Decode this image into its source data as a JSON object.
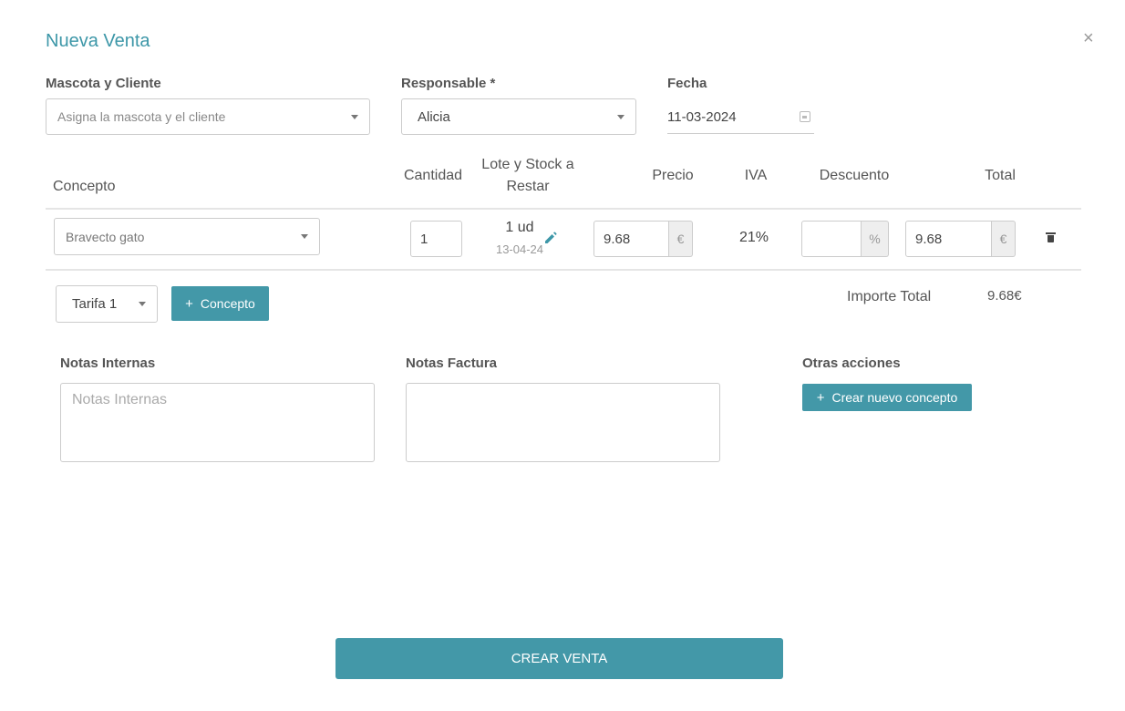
{
  "modal": {
    "title": "Nueva Venta",
    "close_symbol": "×"
  },
  "form": {
    "pet_client": {
      "label": "Mascota y Cliente",
      "placeholder": "Asigna la mascota y el cliente"
    },
    "responsible": {
      "label": "Responsable *",
      "value": "Alicia"
    },
    "date": {
      "label": "Fecha",
      "value": "11-03-2024"
    }
  },
  "table": {
    "headers": {
      "concept": "Concepto",
      "quantity": "Cantidad",
      "batch_line1": "Lote y Stock a",
      "batch_line2": "Restar",
      "price": "Precio",
      "vat": "IVA",
      "discount": "Descuento",
      "total": "Total"
    },
    "rows": [
      {
        "concept": "Bravecto gato",
        "quantity": "1",
        "stock": "1 ud",
        "batch_date": "13-04-24",
        "price": "9.68",
        "price_unit": "€",
        "vat": "21%",
        "discount": "",
        "discount_unit": "%",
        "total": "9.68",
        "total_unit": "€"
      }
    ]
  },
  "footer_row": {
    "tariff": "Tarifa 1",
    "add_concept_label": "Concepto",
    "plus_symbol": "+",
    "total_label": "Importe Total",
    "total_value": "9.68€"
  },
  "notes": {
    "internal_label": "Notas Internas",
    "internal_placeholder": "Notas Internas",
    "invoice_label": "Notas Factura",
    "invoice_value": ""
  },
  "other_actions": {
    "label": "Otras acciones",
    "create_concept_label": "Crear nuevo concepto"
  },
  "submit": {
    "label": "CREAR VENTA"
  },
  "colors": {
    "accent": "#4398a8",
    "title": "#3d97a8"
  },
  "icons": [
    "close-icon",
    "chevron-down-icon",
    "calendar-icon",
    "pencil-icon",
    "trash-icon"
  ]
}
